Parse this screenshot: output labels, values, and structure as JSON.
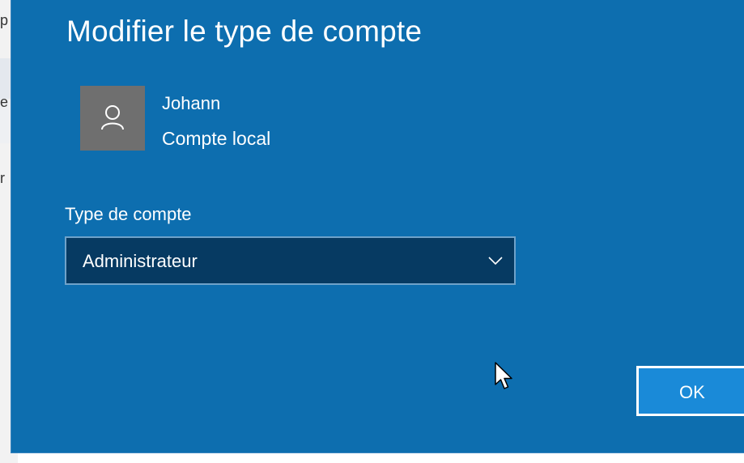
{
  "background_window": {
    "fragments": [
      "p",
      "e",
      "r"
    ]
  },
  "dialog": {
    "title": "Modifier le type de compte",
    "user": {
      "name": "Johann",
      "account_kind": "Compte local",
      "avatar_icon": "person-icon"
    },
    "account_type_label": "Type de compte",
    "account_type_select": {
      "selected_value": "Administrateur",
      "icon": "chevron-down-icon"
    },
    "ok_button_label": "OK"
  },
  "colors": {
    "dialog_background": "#0d6eaf",
    "select_background": "#063a62",
    "ok_button_background": "#1a8ad8",
    "avatar_background": "#6f6f6f"
  }
}
